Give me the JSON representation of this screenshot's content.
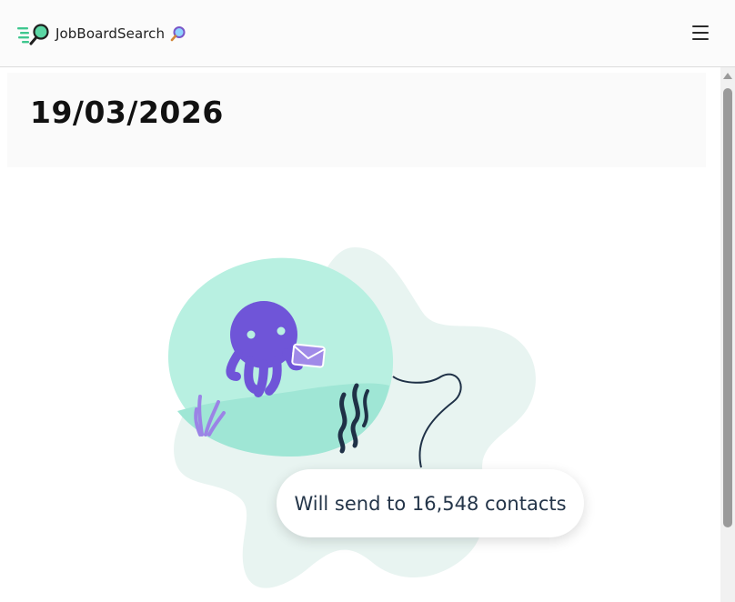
{
  "header": {
    "brand_name": "JobBoardSearch",
    "brand_logo_icon": "magnifier-speed-logo-icon",
    "brand_emoji_icon": "magnifying-glass-icon",
    "menu_icon": "hamburger-menu-icon"
  },
  "main": {
    "date_title": "19/03/2026",
    "illustration_icon": "octopus-sending-mail-illustration",
    "send_status": "Will send to 16,548 contacts"
  },
  "colors": {
    "accent_teal": "#b8f0e1",
    "octopus_purple": "#6f55d8",
    "text_dark": "#243549"
  }
}
